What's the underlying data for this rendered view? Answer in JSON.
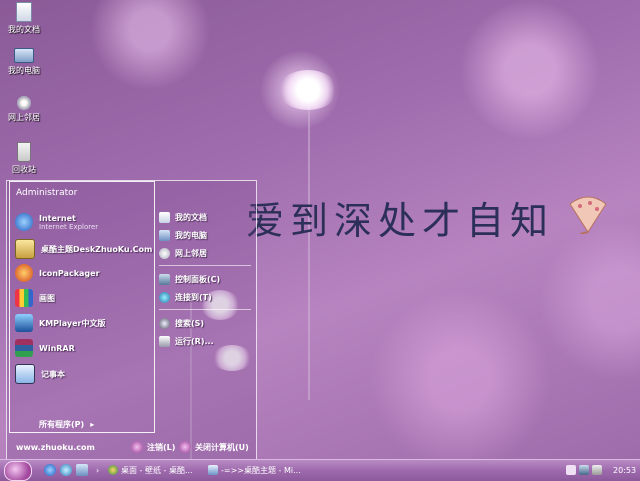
{
  "desktop": {
    "icons": [
      {
        "label": "我的文档",
        "icon": "documents-icon"
      },
      {
        "label": "我的电脑",
        "icon": "computer-icon"
      },
      {
        "label": "网上邻居",
        "icon": "network-icon"
      },
      {
        "label": "回收站",
        "icon": "recycle-bin-icon"
      }
    ],
    "wallpaper_text": "爱到深处才自知"
  },
  "start_menu": {
    "user": "Administrator",
    "pinned": [
      {
        "title": "Internet",
        "subtitle": "Internet Explorer"
      },
      {
        "title": "桌酷主题DeskZhuoKu.Com",
        "subtitle": ""
      }
    ],
    "programs": [
      {
        "title": "IconPackager"
      },
      {
        "title": "画图"
      },
      {
        "title": "KMPlayer中文版"
      },
      {
        "title": "WinRAR"
      },
      {
        "title": "记事本"
      }
    ],
    "all_programs": "所有程序(P)",
    "right_items": [
      {
        "label": "我的文档"
      },
      {
        "label": "我的电脑"
      },
      {
        "label": "网上邻居"
      },
      {
        "label": "控制面板(C)"
      },
      {
        "label": "连接到(T)"
      },
      {
        "label": "搜索(S)"
      },
      {
        "label": "运行(R)..."
      }
    ],
    "site": "www.zhuoku.com",
    "logoff": "注销(L)",
    "shutdown": "关闭计算机(U)"
  },
  "taskbar": {
    "tasks": [
      {
        "label": "桌面 - 壁纸 - 桌酷..."
      },
      {
        "label": "-=>>桌酷主题 - Mi..."
      }
    ],
    "clock": "20:53"
  },
  "colors": {
    "accent": "#9e6aad",
    "text": "#ffffff",
    "calligraphy": "#2c2f57"
  }
}
